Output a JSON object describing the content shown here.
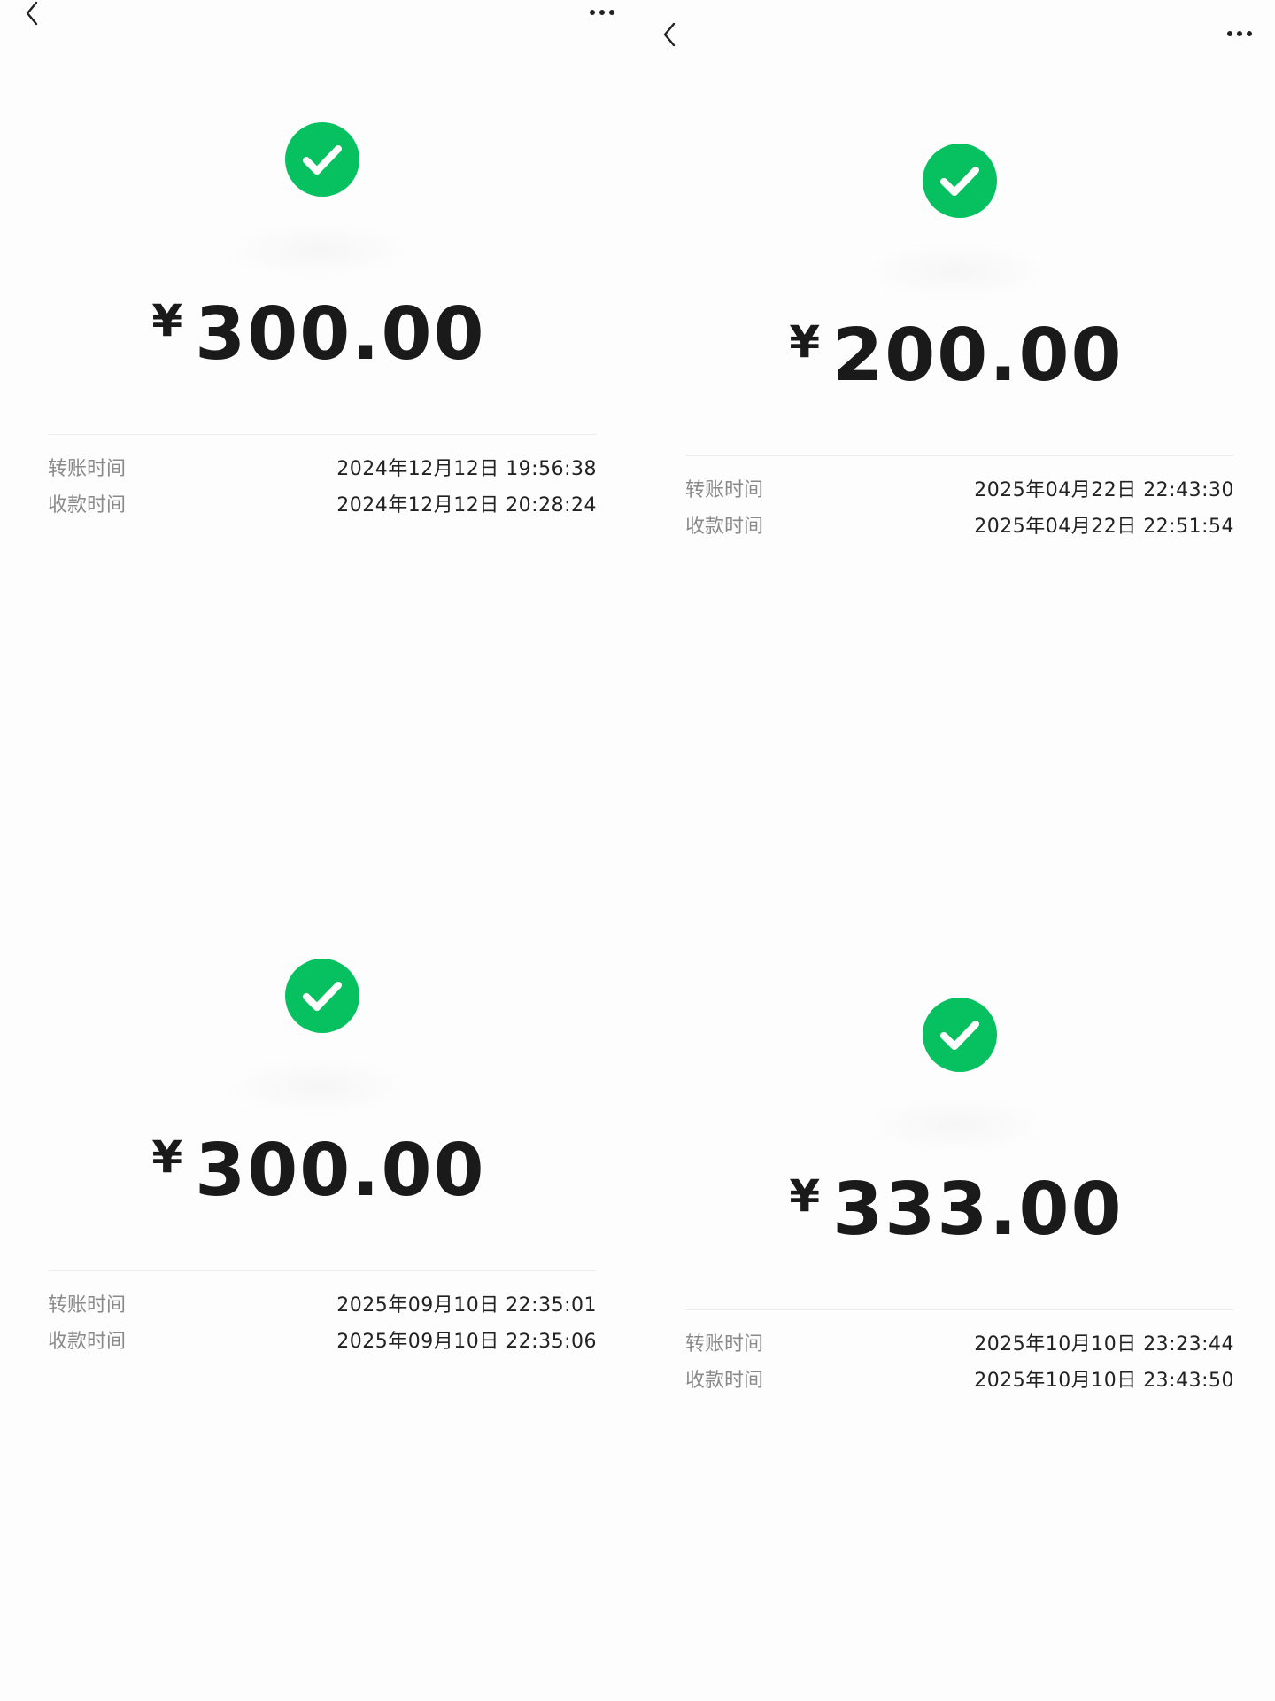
{
  "icons": {
    "back": "chevron-left-icon",
    "more": "more-dots-icon",
    "success": "check-circle-icon"
  },
  "colors": {
    "success_green": "#07c160",
    "amount_text": "#1a1a1a",
    "label_text": "#8a8a8a"
  },
  "labels": {
    "transfer_time": "转账时间",
    "receive_time": "收款时间"
  },
  "receipts": [
    {
      "currency_symbol": "¥",
      "amount": "300.00",
      "transfer_time": "2024年12月12日 19:56:38",
      "receive_time": "2024年12月12日 20:28:24"
    },
    {
      "currency_symbol": "¥",
      "amount": "200.00",
      "transfer_time": "2025年04月22日 22:43:30",
      "receive_time": "2025年04月22日 22:51:54"
    },
    {
      "currency_symbol": "¥",
      "amount": "300.00",
      "transfer_time": "2025年09月10日 22:35:01",
      "receive_time": "2025年09月10日 22:35:06"
    },
    {
      "currency_symbol": "¥",
      "amount": "333.00",
      "transfer_time": "2025年10月10日 23:23:44",
      "receive_time": "2025年10月10日 23:43:50"
    }
  ]
}
